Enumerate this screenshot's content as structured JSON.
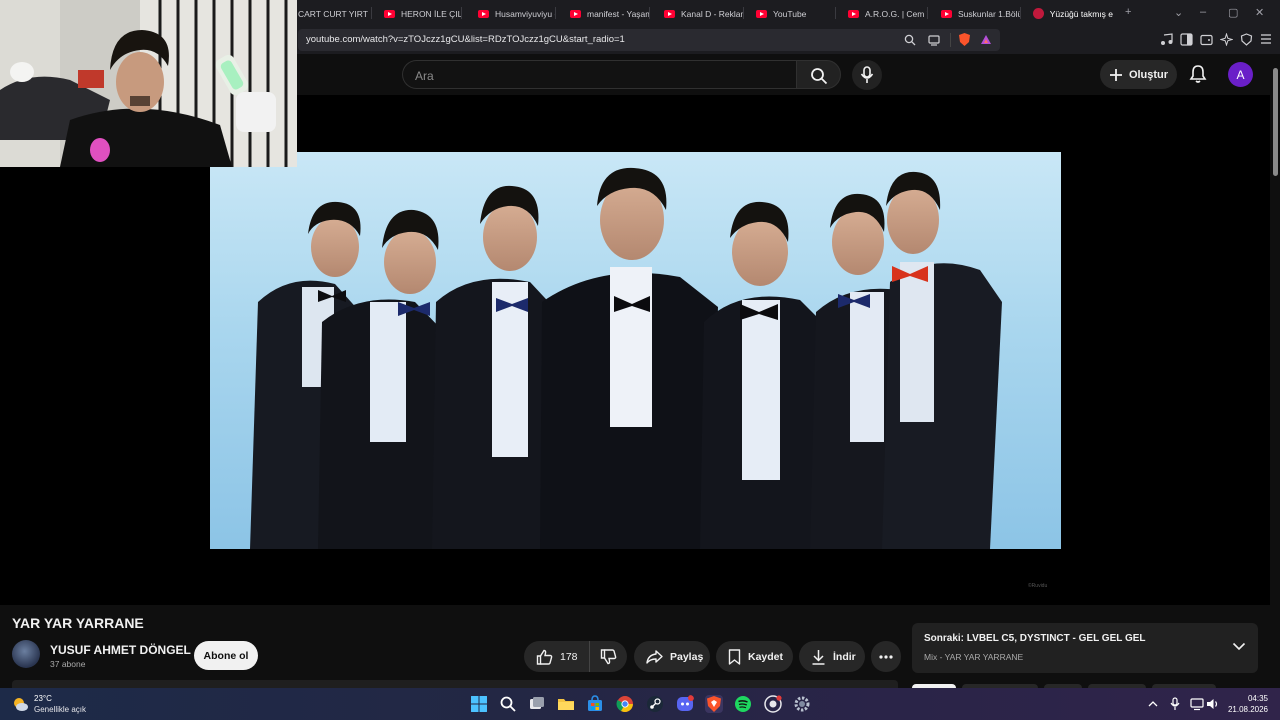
{
  "browser": {
    "tabs": [
      {
        "label": "CART CURT YIRT",
        "youtube": false
      },
      {
        "label": "HERON İLE ÇILGI",
        "youtube": true
      },
      {
        "label": "Husamviyuviyu -",
        "youtube": true
      },
      {
        "label": "manifest - Yaşam",
        "youtube": true
      },
      {
        "label": "Kanal D - Reklam",
        "youtube": true
      },
      {
        "label": "YouTube",
        "youtube": true
      },
      {
        "label": "A.R.O.G. | Cem Y",
        "youtube": true
      },
      {
        "label": "Suskunlar 1.Bölü",
        "youtube": true
      },
      {
        "label": "Yüzüğü takmış e",
        "youtube": true
      }
    ],
    "new_tab": "+",
    "url": "youtube.com/watch?v=zTOJczz1gCU&list=RDzTOJczz1gCU&start_radio=1"
  },
  "header": {
    "search_placeholder": "Ara",
    "create_label": "Oluştur",
    "avatar_letter": "A"
  },
  "video": {
    "title": "YAR YAR YARRANE",
    "watermark": "©Ruvidu"
  },
  "channel": {
    "name": "YUSUF AHMET DÖNGEL",
    "subscribers": "37 abone",
    "subscribe_label": "Abone ol"
  },
  "actions": {
    "like_count": "178",
    "share_label": "Paylaş",
    "save_label": "Kaydet",
    "download_label": "İndir"
  },
  "up_next": {
    "label": "Sonraki: LVBEL C5, DYSTINCT - GEL GEL GEL",
    "subtitle": "Mix - YAR YAR YARRANE"
  },
  "taskbar": {
    "weather_temp": "23°C",
    "weather_desc": "Genellikle açık",
    "time": "04:35",
    "date": "21.08.2026"
  },
  "colors": {
    "youtube_red": "#ff0033",
    "avatar_purple": "#6a1fc8",
    "background": "#0f0f0f"
  }
}
